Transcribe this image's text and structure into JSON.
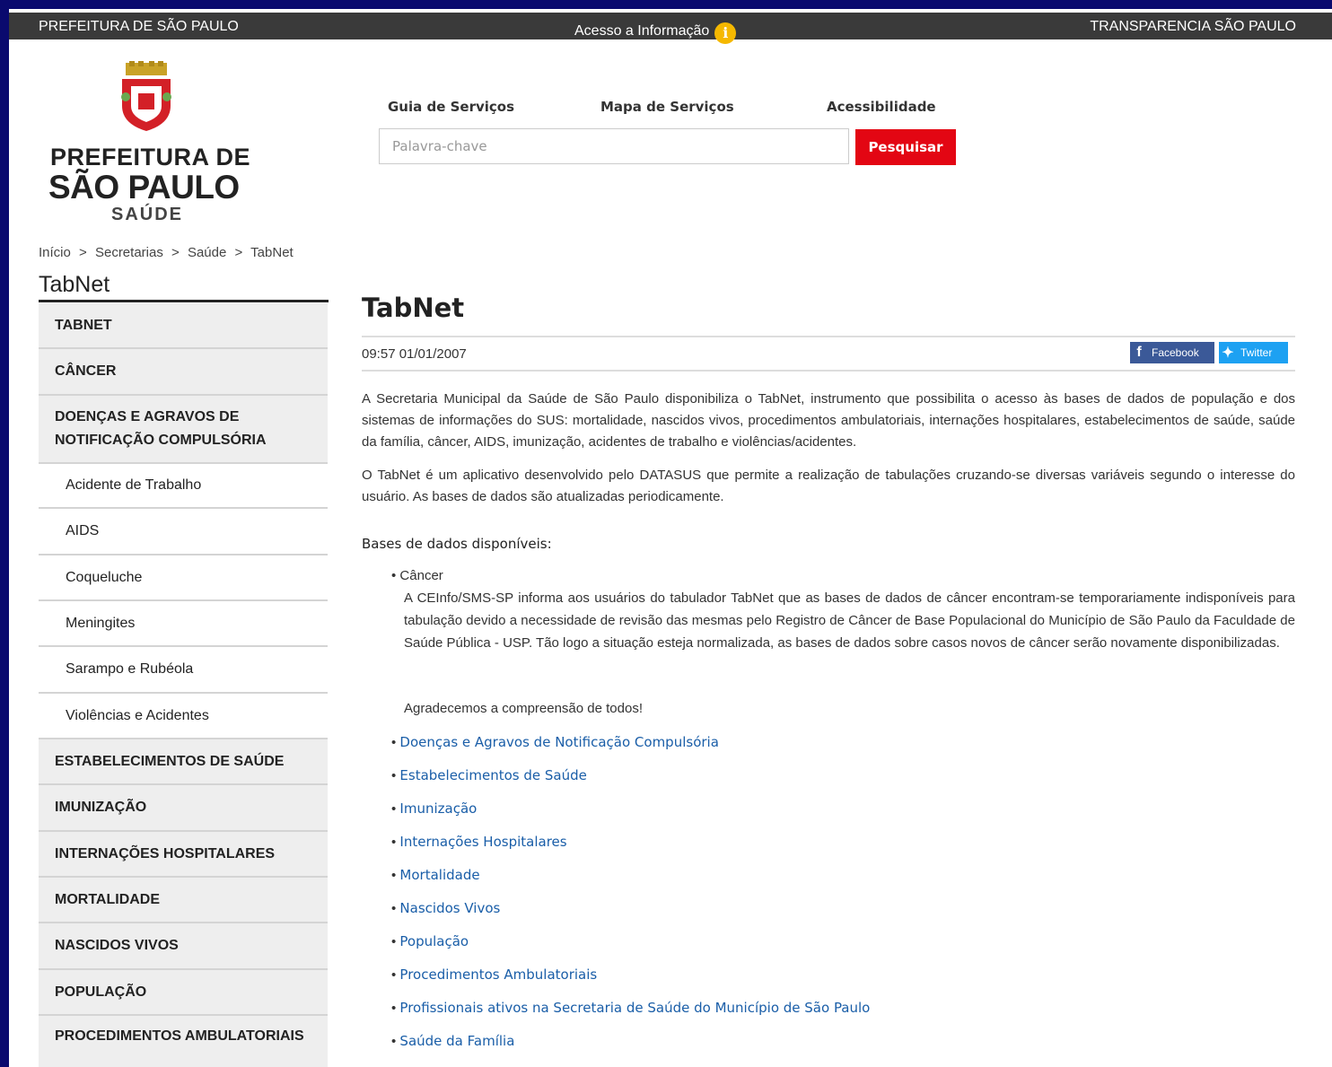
{
  "topbar": {
    "left": "PREFEITURA DE SÃO PAULO",
    "center": "Acesso a Informação",
    "right": "TRANSPARENCIA SÃO PAULO"
  },
  "logo": {
    "line1": "PREFEITURA DE",
    "line2": "SÃO PAULO",
    "line3": "SAÚDE"
  },
  "nav": {
    "guia": "Guia de Serviços",
    "mapa": "Mapa de Serviços",
    "acess": "Acessibilidade"
  },
  "search": {
    "placeholder": "Palavra-chave",
    "button": "Pesquisar"
  },
  "breadcrumb": {
    "items": [
      "Início",
      ">",
      "Secretarias",
      ">",
      "Saúde",
      ">",
      "TabNet"
    ]
  },
  "sidebar": {
    "title": "TabNet",
    "items": [
      {
        "label": "TABNET",
        "type": "main"
      },
      {
        "label": "CÂNCER",
        "type": "main"
      },
      {
        "label": "DOENÇAS E AGRAVOS DE NOTIFICAÇÃO COMPULSÓRIA",
        "type": "main"
      },
      {
        "label": "Acidente de Trabalho",
        "type": "sub"
      },
      {
        "label": "AIDS",
        "type": "sub"
      },
      {
        "label": "Coqueluche",
        "type": "sub"
      },
      {
        "label": "Meningites",
        "type": "sub"
      },
      {
        "label": "Sarampo e Rubéola",
        "type": "sub"
      },
      {
        "label": "Violências e Acidentes",
        "type": "sub"
      },
      {
        "label": "ESTABELECIMENTOS DE SAÚDE",
        "type": "main"
      },
      {
        "label": "IMUNIZAÇÃO",
        "type": "main"
      },
      {
        "label": "INTERNAÇÕES HOSPITALARES",
        "type": "main"
      },
      {
        "label": "MORTALIDADE",
        "type": "main"
      },
      {
        "label": "NASCIDOS VIVOS",
        "type": "main"
      },
      {
        "label": "POPULAÇÃO",
        "type": "main"
      },
      {
        "label": "PROCEDIMENTOS AMBULATORIAIS",
        "type": "main"
      }
    ]
  },
  "content": {
    "title": "TabNet",
    "date": "09:57 01/01/2007",
    "share_facebook": "Facebook",
    "share_twitter": "Twitter",
    "para1": "A Secretaria Municipal da Saúde de São Paulo disponibiliza o TabNet, instrumento que possibilita o acesso às bases de dados de população e dos sistemas de informações do SUS: mortalidade, nascidos vivos, procedimentos ambulatoriais, internações hospitalares, estabelecimentos de saúde, saúde da família, câncer, AIDS, imunização, acidentes de trabalho e violências/acidentes.",
    "para2": "O TabNet é um aplicativo desenvolvido pelo DATASUS que permite a realização de tabulações cruzando-se diversas variáveis segundo o interesse do usuário. As bases de dados são atualizadas periodicamente.",
    "bases_label": "Bases de dados disponíveis:",
    "cancer_label": "Câncer",
    "cancer_note": "A CEInfo/SMS-SP informa aos usuários do tabulador TabNet que as bases de dados de câncer encontram-se temporariamente indisponíveis para tabulação devido a necessidade de revisão das mesmas pelo Registro de Câncer de Base Populacional do Município de São Paulo da Faculdade de Saúde Pública - USP. Tão logo a situação esteja normalizada, as bases de dados sobre casos novos de câncer serão novamente disponibilizadas.",
    "cancer_thanks": "Agradecemos a compreensão de todos!",
    "links": [
      "Doenças e Agravos de Notificação Compulsória",
      "Estabelecimentos de Saúde",
      "Imunização",
      "Internações Hospitalares",
      "Mortalidade",
      "Nascidos Vivos",
      "População",
      "Procedimentos Ambulatoriais",
      "Profissionais ativos na Secretaria de Saúde do Município de São Paulo",
      "Saúde da Família"
    ]
  },
  "colors": {
    "frame": "#0a0a6e",
    "topbar": "#3a3a3a",
    "search_button": "#e30613",
    "link": "#1a5ea8",
    "facebook": "#3b5998",
    "twitter": "#1da1f2"
  }
}
